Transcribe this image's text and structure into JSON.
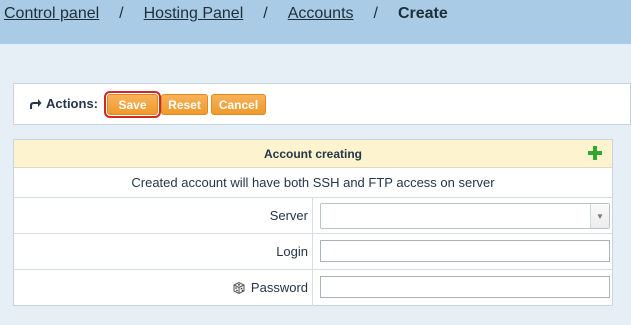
{
  "breadcrumb": {
    "items": [
      "Control panel",
      "Hosting Panel",
      "Accounts"
    ],
    "separator": "/",
    "current": "Create"
  },
  "actions": {
    "label": "Actions:",
    "save_label": "Save",
    "reset_label": "Reset",
    "cancel_label": "Cancel"
  },
  "form": {
    "title": "Account creating",
    "info": "Created account will have both SSH and FTP access on server",
    "fields": {
      "server": {
        "label": "Server",
        "value": ""
      },
      "login": {
        "label": "Login",
        "value": ""
      },
      "password": {
        "label": "Password",
        "value": ""
      }
    }
  },
  "icons": {
    "actions": "share-arrow-icon",
    "add": "plus-icon",
    "password_generator": "dice-icon",
    "dropdown": "chevron-down-icon"
  },
  "colors": {
    "topbar": "#a9cbe6",
    "page_bg": "#e6eef6",
    "button": "#ef9a2c",
    "header_bg": "#fdf3cf",
    "highlight": "#d22828",
    "plus": "#2ea82e"
  }
}
